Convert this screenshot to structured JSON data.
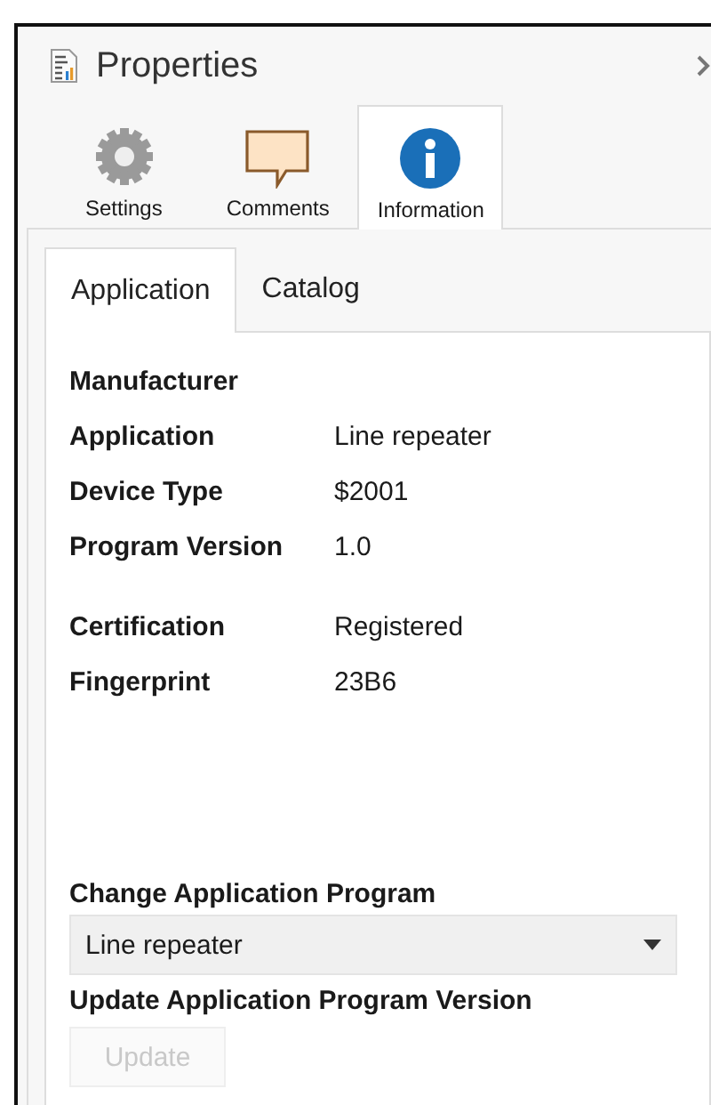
{
  "panel": {
    "title": "Properties"
  },
  "main_tabs": [
    {
      "label": "Settings",
      "kind": "gear",
      "selected": false
    },
    {
      "label": "Comments",
      "kind": "comment",
      "selected": false
    },
    {
      "label": "Information",
      "kind": "info",
      "selected": true
    }
  ],
  "sub_tabs": [
    {
      "label": "Application",
      "selected": true
    },
    {
      "label": "Catalog",
      "selected": false
    }
  ],
  "field_groups": [
    [
      {
        "label": "Manufacturer"
      },
      {
        "label": "Application",
        "value": "Line repeater"
      },
      {
        "label": "Device Type",
        "value": "$2001"
      },
      {
        "label": "Program Version",
        "value": "1.0"
      }
    ],
    [
      {
        "label": "Certification",
        "value": "Registered"
      },
      {
        "label": "Fingerprint",
        "value": "23B6"
      }
    ]
  ],
  "change_program": {
    "label": "Change Application Program",
    "value": "Line repeater"
  },
  "update_version": {
    "label": "Update Application Program Version",
    "button": {
      "label": "Update",
      "disabled": true
    }
  }
}
